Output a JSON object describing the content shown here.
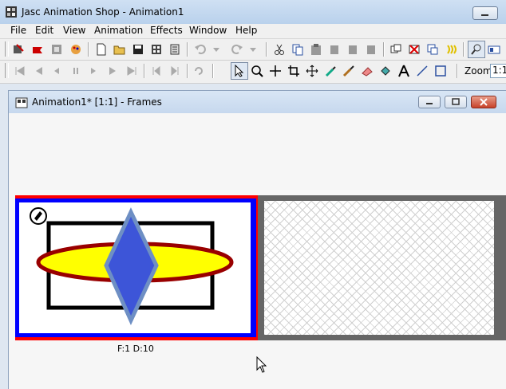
{
  "app": {
    "title": "Jasc Animation Shop - Animation1"
  },
  "menu": [
    "File",
    "Edit",
    "View",
    "Animation",
    "Effects",
    "Window",
    "Help"
  ],
  "toolbar": {
    "zoom_label": "Zoom:",
    "zoom_value": "1:1"
  },
  "child_window": {
    "title": "Animation1* [1:1] - Frames"
  },
  "frames": [
    {
      "label": "F:1   D:10",
      "selected": true
    },
    {
      "label": "",
      "selected": false,
      "transparent": true
    }
  ],
  "colors": {
    "selection_border": "#ff0000",
    "frame_border": "#0000ff",
    "ellipse_fill": "#ffff00",
    "ellipse_stroke": "#990000",
    "diamond_fill": "#3d55d8",
    "diamond_stroke": "#6e8fc4"
  }
}
